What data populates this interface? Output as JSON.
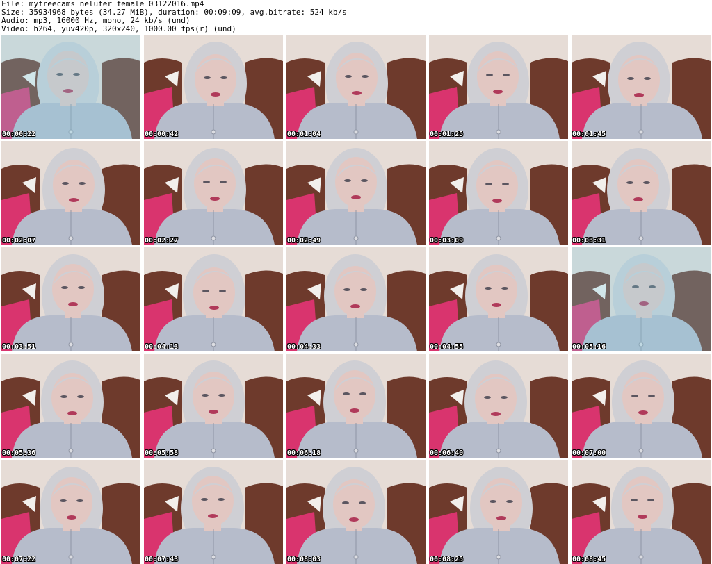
{
  "header": {
    "file_line": "File: myfreecams_nelufer_female_03122016.mp4",
    "size_line": "Size: 35934968 bytes (34.27 MiB), duration: 00:09:09, avg.bitrate: 524 kb/s",
    "audio_line": "Audio: mp3, 16000 Hz, mono, 24 kb/s (und)",
    "video_line": "Video: h264, yuv420p, 320x240, 1000.00 fps(r) (und)"
  },
  "thumbnails": [
    {
      "timestamp": "00:00:22",
      "tint": "cool"
    },
    {
      "timestamp": "00:00:42",
      "tint": "warm"
    },
    {
      "timestamp": "00:01:04",
      "tint": "warm"
    },
    {
      "timestamp": "00:01:25",
      "tint": "warm"
    },
    {
      "timestamp": "00:01:45",
      "tint": "warm"
    },
    {
      "timestamp": "00:02:07",
      "tint": "warm"
    },
    {
      "timestamp": "00:02:27",
      "tint": "warm"
    },
    {
      "timestamp": "00:02:49",
      "tint": "warm"
    },
    {
      "timestamp": "00:03:09",
      "tint": "warm"
    },
    {
      "timestamp": "00:03:31",
      "tint": "warm"
    },
    {
      "timestamp": "00:03:51",
      "tint": "warm"
    },
    {
      "timestamp": "00:04:13",
      "tint": "warm"
    },
    {
      "timestamp": "00:04:33",
      "tint": "warm"
    },
    {
      "timestamp": "00:04:55",
      "tint": "warm"
    },
    {
      "timestamp": "00:05:16",
      "tint": "cool"
    },
    {
      "timestamp": "00:05:36",
      "tint": "warm"
    },
    {
      "timestamp": "00:05:58",
      "tint": "warm"
    },
    {
      "timestamp": "00:06:18",
      "tint": "warm"
    },
    {
      "timestamp": "00:06:40",
      "tint": "warm"
    },
    {
      "timestamp": "00:07:00",
      "tint": "warm"
    },
    {
      "timestamp": "00:07:22",
      "tint": "warm"
    },
    {
      "timestamp": "00:07:43",
      "tint": "warm"
    },
    {
      "timestamp": "00:08:03",
      "tint": "warm"
    },
    {
      "timestamp": "00:08:25",
      "tint": "warm"
    },
    {
      "timestamp": "00:08:45",
      "tint": "warm"
    }
  ],
  "colors": {
    "background": "#ffffff",
    "wall": "#e6dcd6",
    "headboard": "#6e3a2c",
    "pillow": "#d9346e",
    "hair": "#cfcfd4",
    "skin": "#e2c7c2",
    "sweater": "#b6bccb",
    "lips": "#b03a5a",
    "cool_tint": "#7fd0e6"
  }
}
